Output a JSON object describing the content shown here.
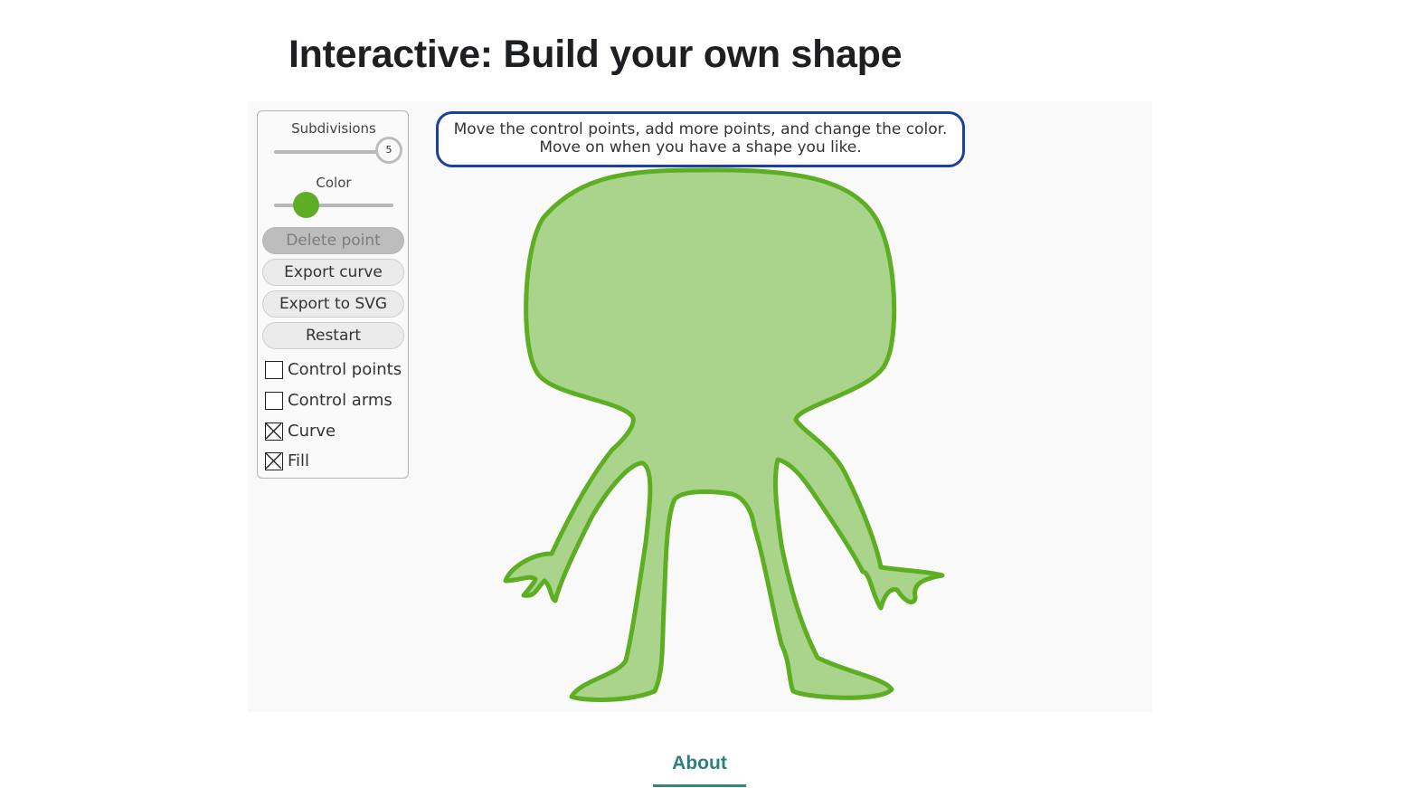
{
  "page": {
    "title": "Interactive: Build your own shape"
  },
  "panel": {
    "subdivisions_label": "Subdivisions",
    "subdivisions_value": "5",
    "color_label": "Color",
    "buttons": {
      "delete_point": "Delete point",
      "export_curve": "Export curve",
      "export_svg": "Export to SVG",
      "restart": "Restart"
    },
    "checkboxes": {
      "control_points": {
        "label": "Control points",
        "checked": false
      },
      "control_arms": {
        "label": "Control arms",
        "checked": false
      },
      "curve": {
        "label": "Curve",
        "checked": true
      },
      "fill": {
        "label": "Fill",
        "checked": true
      }
    }
  },
  "instruction": {
    "line1": "Move the control points, add more points, and change the color.",
    "line2": "Move on when you have a shape you like."
  },
  "shape": {
    "fill_color": "#aad48c",
    "stroke_color": "#5eae24"
  },
  "footer": {
    "about_label": "About"
  }
}
